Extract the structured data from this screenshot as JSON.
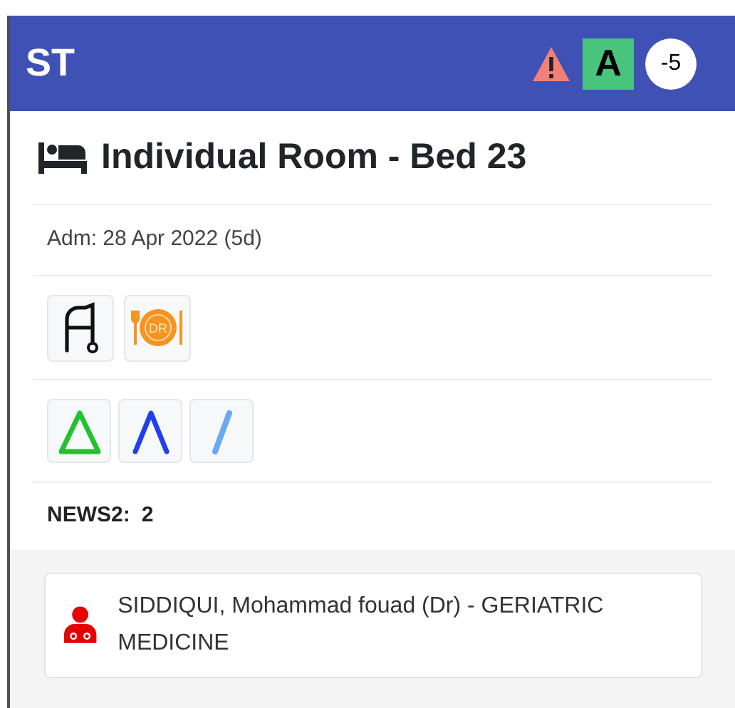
{
  "header": {
    "initials": "ST",
    "badges": [
      {
        "kind": "warning"
      },
      {
        "kind": "letter",
        "text": "A"
      },
      {
        "kind": "score",
        "text": "-5"
      }
    ]
  },
  "location": "Individual Room - Bed 23",
  "admission": "Adm: 28 Apr 2022 (5d)",
  "care_icons": [
    {
      "kind": "walker"
    },
    {
      "kind": "diet",
      "text": "DR"
    }
  ],
  "trend_icons": [
    {
      "kind": "triangle",
      "color": "#22c22e"
    },
    {
      "kind": "caret",
      "color": "#1f3ff0"
    },
    {
      "kind": "slash",
      "color": "#6aa8f5"
    }
  ],
  "news2": {
    "label": "NEWS2:",
    "value": "2"
  },
  "clinician": "SIDDIQUI, Mohammad fouad (Dr) - GERIATRIC MEDICINE"
}
